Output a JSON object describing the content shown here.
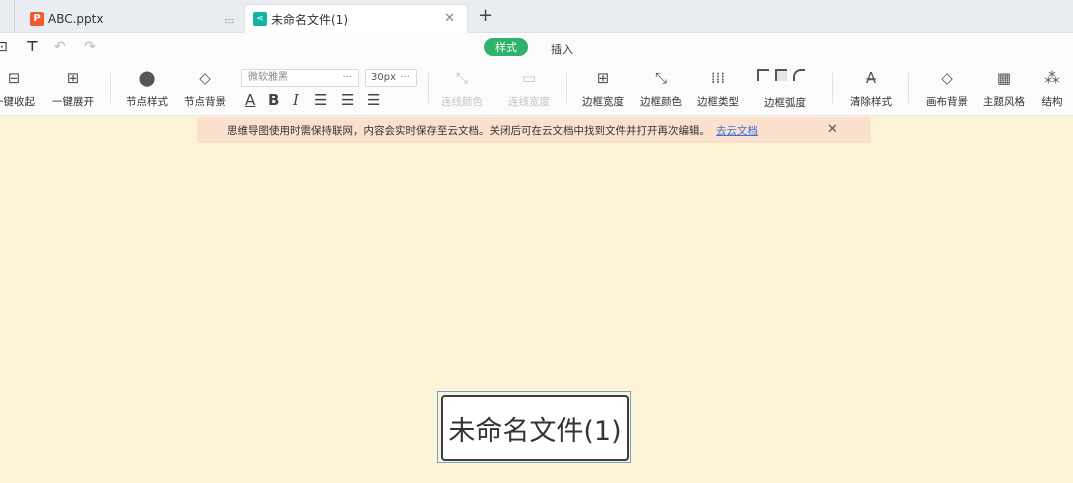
{
  "tabs": [
    {
      "label": "ABC.pptx",
      "icon": "pptx-file-icon"
    },
    {
      "label": "未命名文件(1)",
      "icon": "mindmap-file-icon"
    }
  ],
  "top": {
    "style_label": "样式",
    "insert_label": "插入"
  },
  "ribbon": {
    "collapse_all": "一键收起",
    "expand_all": "一键展开",
    "node_style": "节点样式",
    "node_background": "节点背景",
    "font_name": "微软雅黑",
    "font_size": "30px",
    "line_color": "连线颜色",
    "line_width": "连线宽度",
    "border_width": "边框宽度",
    "border_color": "边框颜色",
    "border_type": "边框类型",
    "border_radius": "边框弧度",
    "clear_style": "清除样式",
    "canvas_background": "画布背景",
    "theme_style": "主题风格",
    "structure": "结构",
    "format_a": "A",
    "format_b": "B",
    "format_i": "I"
  },
  "notice": {
    "text": "思维导图使用时需保持联网，内容会实时保存至云文档。关闭后可在云文档中找到文件并打开再次编辑。",
    "link": "去云文档"
  },
  "canvas": {
    "root_node": "未命名文件(1)"
  },
  "colors": {
    "canvas_bg": "#fdf3d6",
    "accent_green": "#2fb26c",
    "notice_bg": "#fbe0cd",
    "link": "#3b6fd9"
  }
}
